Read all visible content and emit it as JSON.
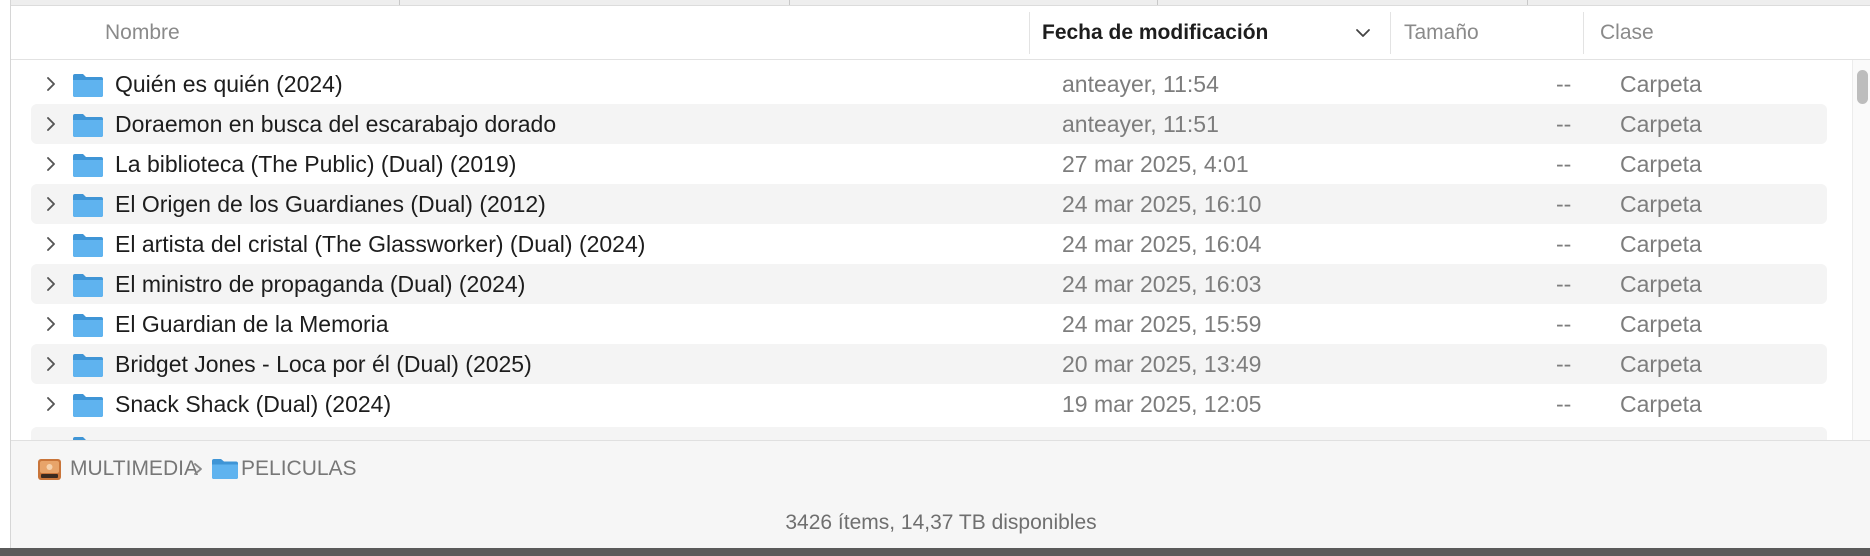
{
  "columns": {
    "name": "Nombre",
    "date": "Fecha de modificación",
    "size": "Tamaño",
    "kind": "Clase",
    "sorted_by": "date",
    "sort_icon": "chevron-down-icon"
  },
  "rows": [
    {
      "name": "Quién es quién (2024)",
      "date": "anteayer, 11:54",
      "size": "--",
      "kind": "Carpeta"
    },
    {
      "name": "Doraemon en busca del escarabajo dorado",
      "date": "anteayer, 11:51",
      "size": "--",
      "kind": "Carpeta"
    },
    {
      "name": "La biblioteca (The Public) (Dual) (2019)",
      "date": "27 mar 2025, 4:01",
      "size": "--",
      "kind": "Carpeta"
    },
    {
      "name": "El Origen de los Guardianes (Dual) (2012)",
      "date": "24 mar 2025, 16:10",
      "size": "--",
      "kind": "Carpeta"
    },
    {
      "name": "El artista del cristal (The Glassworker) (Dual) (2024)",
      "date": "24 mar 2025, 16:04",
      "size": "--",
      "kind": "Carpeta"
    },
    {
      "name": "El ministro de propaganda (Dual) (2024)",
      "date": "24 mar 2025, 16:03",
      "size": "--",
      "kind": "Carpeta"
    },
    {
      "name": "El Guardian de la Memoria",
      "date": "24 mar 2025, 15:59",
      "size": "--",
      "kind": "Carpeta"
    },
    {
      "name": "Bridget Jones - Loca por él (Dual) (2025)",
      "date": "20 mar 2025, 13:49",
      "size": "--",
      "kind": "Carpeta"
    },
    {
      "name": "Snack Shack (Dual) (2024)",
      "date": "19 mar 2025, 12:05",
      "size": "--",
      "kind": "Carpeta"
    }
  ],
  "pathbar": {
    "items": [
      {
        "label": "MULTIMEDIA",
        "icon": "external-drive-icon"
      },
      {
        "label": "PELICULAS",
        "icon": "folder-icon"
      }
    ]
  },
  "status": {
    "text": "3426 ítems, 14,37 TB disponibles"
  },
  "colors": {
    "folder": "#5fb3ef",
    "folder_dark": "#3f95d6",
    "row_alt": "#f4f4f4",
    "secondary_text": "#7d7d7d"
  }
}
